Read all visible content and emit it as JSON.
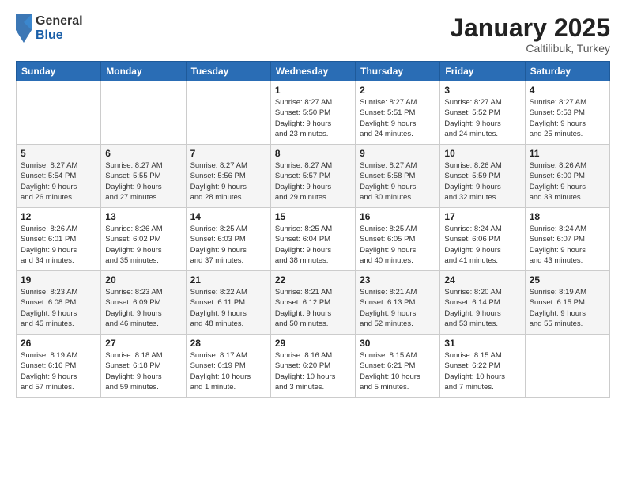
{
  "logo": {
    "general": "General",
    "blue": "Blue",
    "icon_title": "GeneralBlue Logo"
  },
  "title": {
    "month_year": "January 2025",
    "location": "Caltilibuk, Turkey"
  },
  "weekdays": [
    "Sunday",
    "Monday",
    "Tuesday",
    "Wednesday",
    "Thursday",
    "Friday",
    "Saturday"
  ],
  "weeks": [
    {
      "days": [
        {
          "num": "",
          "info": ""
        },
        {
          "num": "",
          "info": ""
        },
        {
          "num": "",
          "info": ""
        },
        {
          "num": "1",
          "info": "Sunrise: 8:27 AM\nSunset: 5:50 PM\nDaylight: 9 hours\nand 23 minutes."
        },
        {
          "num": "2",
          "info": "Sunrise: 8:27 AM\nSunset: 5:51 PM\nDaylight: 9 hours\nand 24 minutes."
        },
        {
          "num": "3",
          "info": "Sunrise: 8:27 AM\nSunset: 5:52 PM\nDaylight: 9 hours\nand 24 minutes."
        },
        {
          "num": "4",
          "info": "Sunrise: 8:27 AM\nSunset: 5:53 PM\nDaylight: 9 hours\nand 25 minutes."
        }
      ]
    },
    {
      "days": [
        {
          "num": "5",
          "info": "Sunrise: 8:27 AM\nSunset: 5:54 PM\nDaylight: 9 hours\nand 26 minutes."
        },
        {
          "num": "6",
          "info": "Sunrise: 8:27 AM\nSunset: 5:55 PM\nDaylight: 9 hours\nand 27 minutes."
        },
        {
          "num": "7",
          "info": "Sunrise: 8:27 AM\nSunset: 5:56 PM\nDaylight: 9 hours\nand 28 minutes."
        },
        {
          "num": "8",
          "info": "Sunrise: 8:27 AM\nSunset: 5:57 PM\nDaylight: 9 hours\nand 29 minutes."
        },
        {
          "num": "9",
          "info": "Sunrise: 8:27 AM\nSunset: 5:58 PM\nDaylight: 9 hours\nand 30 minutes."
        },
        {
          "num": "10",
          "info": "Sunrise: 8:26 AM\nSunset: 5:59 PM\nDaylight: 9 hours\nand 32 minutes."
        },
        {
          "num": "11",
          "info": "Sunrise: 8:26 AM\nSunset: 6:00 PM\nDaylight: 9 hours\nand 33 minutes."
        }
      ]
    },
    {
      "days": [
        {
          "num": "12",
          "info": "Sunrise: 8:26 AM\nSunset: 6:01 PM\nDaylight: 9 hours\nand 34 minutes."
        },
        {
          "num": "13",
          "info": "Sunrise: 8:26 AM\nSunset: 6:02 PM\nDaylight: 9 hours\nand 35 minutes."
        },
        {
          "num": "14",
          "info": "Sunrise: 8:25 AM\nSunset: 6:03 PM\nDaylight: 9 hours\nand 37 minutes."
        },
        {
          "num": "15",
          "info": "Sunrise: 8:25 AM\nSunset: 6:04 PM\nDaylight: 9 hours\nand 38 minutes."
        },
        {
          "num": "16",
          "info": "Sunrise: 8:25 AM\nSunset: 6:05 PM\nDaylight: 9 hours\nand 40 minutes."
        },
        {
          "num": "17",
          "info": "Sunrise: 8:24 AM\nSunset: 6:06 PM\nDaylight: 9 hours\nand 41 minutes."
        },
        {
          "num": "18",
          "info": "Sunrise: 8:24 AM\nSunset: 6:07 PM\nDaylight: 9 hours\nand 43 minutes."
        }
      ]
    },
    {
      "days": [
        {
          "num": "19",
          "info": "Sunrise: 8:23 AM\nSunset: 6:08 PM\nDaylight: 9 hours\nand 45 minutes."
        },
        {
          "num": "20",
          "info": "Sunrise: 8:23 AM\nSunset: 6:09 PM\nDaylight: 9 hours\nand 46 minutes."
        },
        {
          "num": "21",
          "info": "Sunrise: 8:22 AM\nSunset: 6:11 PM\nDaylight: 9 hours\nand 48 minutes."
        },
        {
          "num": "22",
          "info": "Sunrise: 8:21 AM\nSunset: 6:12 PM\nDaylight: 9 hours\nand 50 minutes."
        },
        {
          "num": "23",
          "info": "Sunrise: 8:21 AM\nSunset: 6:13 PM\nDaylight: 9 hours\nand 52 minutes."
        },
        {
          "num": "24",
          "info": "Sunrise: 8:20 AM\nSunset: 6:14 PM\nDaylight: 9 hours\nand 53 minutes."
        },
        {
          "num": "25",
          "info": "Sunrise: 8:19 AM\nSunset: 6:15 PM\nDaylight: 9 hours\nand 55 minutes."
        }
      ]
    },
    {
      "days": [
        {
          "num": "26",
          "info": "Sunrise: 8:19 AM\nSunset: 6:16 PM\nDaylight: 9 hours\nand 57 minutes."
        },
        {
          "num": "27",
          "info": "Sunrise: 8:18 AM\nSunset: 6:18 PM\nDaylight: 9 hours\nand 59 minutes."
        },
        {
          "num": "28",
          "info": "Sunrise: 8:17 AM\nSunset: 6:19 PM\nDaylight: 10 hours\nand 1 minute."
        },
        {
          "num": "29",
          "info": "Sunrise: 8:16 AM\nSunset: 6:20 PM\nDaylight: 10 hours\nand 3 minutes."
        },
        {
          "num": "30",
          "info": "Sunrise: 8:15 AM\nSunset: 6:21 PM\nDaylight: 10 hours\nand 5 minutes."
        },
        {
          "num": "31",
          "info": "Sunrise: 8:15 AM\nSunset: 6:22 PM\nDaylight: 10 hours\nand 7 minutes."
        },
        {
          "num": "",
          "info": ""
        }
      ]
    }
  ]
}
